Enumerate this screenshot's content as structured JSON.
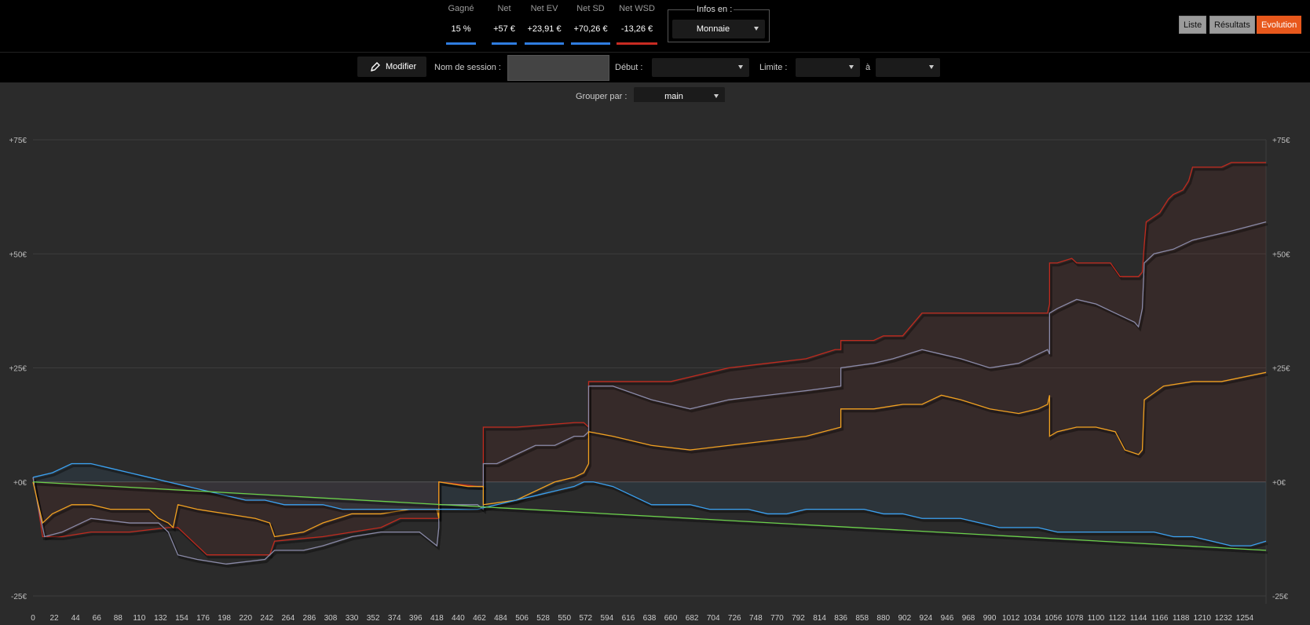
{
  "header": {
    "stats": [
      {
        "label": "Gagné",
        "value": "15 %",
        "color": "#2f7de0"
      },
      {
        "label": "Net",
        "value": "+57 €",
        "color": "#2f7de0"
      },
      {
        "label": "Net EV",
        "value": "+23,91 €",
        "color": "#2f7de0"
      },
      {
        "label": "Net SD",
        "value": "+70,26 €",
        "color": "#2f7de0"
      },
      {
        "label": "Net WSD",
        "value": "-13,26 €",
        "color": "#c82b22"
      }
    ],
    "infos_label": "Infos en :",
    "infos_value": "Monnaie",
    "views": {
      "liste": "Liste",
      "resultats": "Résultats",
      "evolution": "Evolution"
    }
  },
  "toolbar": {
    "modifier": "Modifier",
    "session_label": "Nom de session :",
    "debut_label": "Début :",
    "limite_label": "Limite :",
    "a_label": "à",
    "group_label": "Grouper par :",
    "group_value": "main"
  },
  "colors": {
    "net": "#8a8aa8",
    "ev": "#f0a020",
    "sd": "#c02a1e",
    "wsd": "#3aa0f0",
    "rake": "#6ad04a",
    "active": "#e8581c"
  },
  "chart_data": {
    "type": "line",
    "ylim": [
      -25,
      75
    ],
    "y_ticks": [
      "+75€",
      "+50€",
      "+25€",
      "+0€",
      "-25€"
    ],
    "y_tick_values": [
      75,
      50,
      25,
      0,
      -25
    ],
    "x_ticks": [
      0,
      22,
      44,
      66,
      88,
      110,
      132,
      154,
      176,
      198,
      220,
      242,
      264,
      286,
      308,
      330,
      352,
      374,
      396,
      418,
      440,
      462,
      484,
      506,
      528,
      550,
      572,
      594,
      616,
      638,
      660,
      682,
      704,
      726,
      748,
      770,
      792,
      814,
      836,
      858,
      880,
      902,
      924,
      946,
      968,
      990,
      1012,
      1034,
      1056,
      1078,
      1100,
      1122,
      1144,
      1166,
      1188,
      1210,
      1232,
      1254
    ],
    "xlim": [
      0,
      1276
    ],
    "series": [
      {
        "key": "sd",
        "x": [
          0,
          5,
          10,
          30,
          60,
          100,
          140,
          150,
          180,
          220,
          245,
          250,
          300,
          360,
          380,
          420,
          420,
          460,
          466,
          466,
          485,
          500,
          560,
          570,
          575,
          575,
          620,
          660,
          680,
          720,
          760,
          800,
          830,
          836,
          836,
          870,
          880,
          900,
          920,
          1050,
          1052,
          1052,
          1060,
          1075,
          1080,
          1115,
          1125,
          1144,
          1148,
          1150,
          1152,
          1166,
          1175,
          1180,
          1190,
          1196,
          1200,
          1230,
          1240,
          1276
        ],
        "y": [
          1,
          -5,
          -12,
          -12,
          -11,
          -11,
          -10,
          -10,
          -16,
          -16,
          -16,
          -13,
          -12,
          -10,
          -8,
          -8,
          0,
          -1,
          -1,
          12,
          12,
          12,
          13,
          13,
          12,
          22,
          22,
          22,
          23,
          25,
          26,
          27,
          29,
          29,
          31,
          31,
          32,
          32,
          37,
          37,
          39,
          48,
          48,
          49,
          48,
          48,
          45,
          45,
          46,
          52,
          57,
          59,
          62,
          63,
          64,
          66,
          69,
          69,
          70,
          70
        ]
      },
      {
        "key": "net",
        "x": [
          0,
          5,
          12,
          30,
          60,
          100,
          130,
          140,
          150,
          170,
          200,
          240,
          250,
          280,
          300,
          330,
          360,
          400,
          418,
          420,
          420,
          430,
          460,
          466,
          466,
          480,
          500,
          520,
          540,
          560,
          570,
          575,
          575,
          600,
          640,
          680,
          720,
          760,
          800,
          836,
          836,
          870,
          890,
          920,
          940,
          960,
          990,
          1020,
          1040,
          1050,
          1052,
          1052,
          1060,
          1080,
          1100,
          1120,
          1140,
          1144,
          1148,
          1150,
          1160,
          1180,
          1200,
          1220,
          1240,
          1276
        ],
        "y": [
          1,
          -5,
          -12,
          -11,
          -8,
          -9,
          -9,
          -11,
          -16,
          -17,
          -18,
          -17,
          -15,
          -15,
          -14,
          -12,
          -11,
          -11,
          -14,
          -10,
          -5,
          -5,
          -5,
          -6,
          4,
          4,
          6,
          8,
          8,
          10,
          10,
          11,
          21,
          21,
          18,
          16,
          18,
          19,
          20,
          21,
          25,
          26,
          27,
          29,
          28,
          27,
          25,
          26,
          28,
          29,
          28,
          37,
          38,
          40,
          39,
          37,
          35,
          34,
          38,
          48,
          50,
          51,
          53,
          54,
          55,
          57
        ]
      },
      {
        "key": "ev",
        "x": [
          0,
          10,
          20,
          40,
          60,
          80,
          100,
          120,
          130,
          140,
          145,
          150,
          170,
          200,
          230,
          245,
          250,
          280,
          300,
          330,
          360,
          390,
          418,
          420,
          420,
          450,
          466,
          466,
          500,
          520,
          540,
          560,
          570,
          575,
          575,
          600,
          640,
          680,
          720,
          760,
          800,
          836,
          836,
          870,
          900,
          920,
          940,
          960,
          990,
          1020,
          1040,
          1050,
          1052,
          1052,
          1060,
          1080,
          1100,
          1120,
          1130,
          1144,
          1148,
          1150,
          1170,
          1200,
          1230,
          1276
        ],
        "y": [
          0,
          -9,
          -7,
          -5,
          -5,
          -6,
          -6,
          -6,
          -8,
          -9,
          -10,
          -5,
          -6,
          -7,
          -8,
          -9,
          -12,
          -11,
          -9,
          -7,
          -7,
          -6,
          -6,
          -8,
          0,
          -1,
          -1,
          -5,
          -4,
          -2,
          0,
          1,
          2,
          4,
          11,
          10,
          8,
          7,
          8,
          9,
          10,
          12,
          16,
          16,
          17,
          17,
          19,
          18,
          16,
          15,
          16,
          17,
          19,
          10,
          11,
          12,
          12,
          11,
          7,
          6,
          7,
          18,
          21,
          22,
          22,
          24
        ]
      },
      {
        "key": "wsd",
        "x": [
          0,
          20,
          40,
          60,
          80,
          100,
          120,
          140,
          160,
          180,
          200,
          220,
          240,
          260,
          280,
          300,
          320,
          340,
          360,
          380,
          400,
          420,
          440,
          460,
          480,
          500,
          520,
          540,
          560,
          570,
          575,
          580,
          600,
          620,
          640,
          660,
          680,
          700,
          720,
          740,
          760,
          780,
          800,
          820,
          840,
          860,
          880,
          900,
          920,
          940,
          960,
          980,
          1000,
          1020,
          1040,
          1060,
          1080,
          1100,
          1120,
          1140,
          1160,
          1180,
          1200,
          1220,
          1240,
          1260,
          1276
        ],
        "y": [
          1,
          2,
          4,
          4,
          3,
          2,
          1,
          0,
          -1,
          -2,
          -3,
          -4,
          -4,
          -5,
          -5,
          -5,
          -6,
          -6,
          -6,
          -6,
          -6,
          -6,
          -6,
          -6,
          -5,
          -4,
          -3,
          -2,
          -1,
          0,
          0,
          0,
          -1,
          -3,
          -5,
          -5,
          -5,
          -6,
          -6,
          -6,
          -7,
          -7,
          -6,
          -6,
          -6,
          -6,
          -7,
          -7,
          -8,
          -8,
          -8,
          -9,
          -10,
          -10,
          -10,
          -11,
          -11,
          -11,
          -11,
          -11,
          -11,
          -12,
          -12,
          -13,
          -14,
          -14,
          -13
        ]
      },
      {
        "key": "rake",
        "x": [
          0,
          1276
        ],
        "y": [
          0,
          -15
        ]
      }
    ]
  }
}
